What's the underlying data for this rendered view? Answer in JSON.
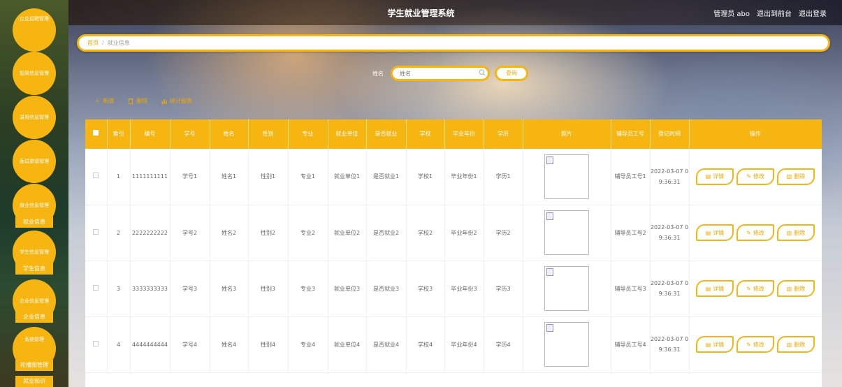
{
  "header": {
    "title": "学生就业管理系统",
    "admin_label": "管理员 abo",
    "front_link": "退出到前台",
    "logout_link": "退出登录"
  },
  "sidebar": {
    "items": [
      {
        "label": "企业招聘管理"
      },
      {
        "label": "投简信息管理"
      },
      {
        "label": "录用信息管理"
      },
      {
        "label": "面试邀请管理"
      },
      {
        "label": "就业信息管理",
        "sub": "就业信息"
      },
      {
        "label": "学生信息管理",
        "sub": "学生信息"
      },
      {
        "label": "企业信息管理",
        "sub": "企业信息"
      },
      {
        "label": "系统管理",
        "subs": [
          "轮播图管理",
          "就业知识"
        ]
      }
    ]
  },
  "breadcrumb": {
    "home": "首页",
    "separator": "/",
    "current": "就业信息"
  },
  "search": {
    "label": "姓名",
    "placeholder": "姓名",
    "button": "查询"
  },
  "toolbar": {
    "add": "新增",
    "delete": "删除",
    "report": "统计报表"
  },
  "table": {
    "headers": [
      "索引",
      "编号",
      "学号",
      "姓名",
      "性别",
      "专业",
      "就业单位",
      "是否就业",
      "学校",
      "毕业年份",
      "学历",
      "照片",
      "辅导员工号",
      "登记时间",
      "操作"
    ],
    "rows": [
      {
        "index": "1",
        "code": "1111111111",
        "student_no": "学号1",
        "name": "姓名1",
        "gender": "性别1",
        "major": "专业1",
        "unit": "就业单位1",
        "employed": "是否就业1",
        "school": "学校1",
        "year": "毕业年份1",
        "degree": "学历1",
        "counselor": "辅导员工号1",
        "time": "2022-03-07 09:36:31"
      },
      {
        "index": "2",
        "code": "2222222222",
        "student_no": "学号2",
        "name": "姓名2",
        "gender": "性别2",
        "major": "专业2",
        "unit": "就业单位2",
        "employed": "是否就业2",
        "school": "学校2",
        "year": "毕业年份2",
        "degree": "学历2",
        "counselor": "辅导员工号2",
        "time": "2022-03-07 09:36:31"
      },
      {
        "index": "3",
        "code": "3333333333",
        "student_no": "学号3",
        "name": "姓名3",
        "gender": "性别3",
        "major": "专业3",
        "unit": "就业单位3",
        "employed": "是否就业3",
        "school": "学校3",
        "year": "毕业年份3",
        "degree": "学历3",
        "counselor": "辅导员工号3",
        "time": "2022-03-07 09:36:31"
      },
      {
        "index": "4",
        "code": "4444444444",
        "student_no": "学号4",
        "name": "姓名4",
        "gender": "性别4",
        "major": "专业4",
        "unit": "就业单位4",
        "employed": "是否就业4",
        "school": "学校4",
        "year": "毕业年份4",
        "degree": "学历4",
        "counselor": "辅导员工号4",
        "time": "2022-03-07 09:36:31"
      }
    ],
    "actions": {
      "detail": "详情",
      "edit": "修改",
      "delete": "删除"
    }
  },
  "colors": {
    "accent": "#f7b512",
    "accent_text": "#f0a800"
  }
}
